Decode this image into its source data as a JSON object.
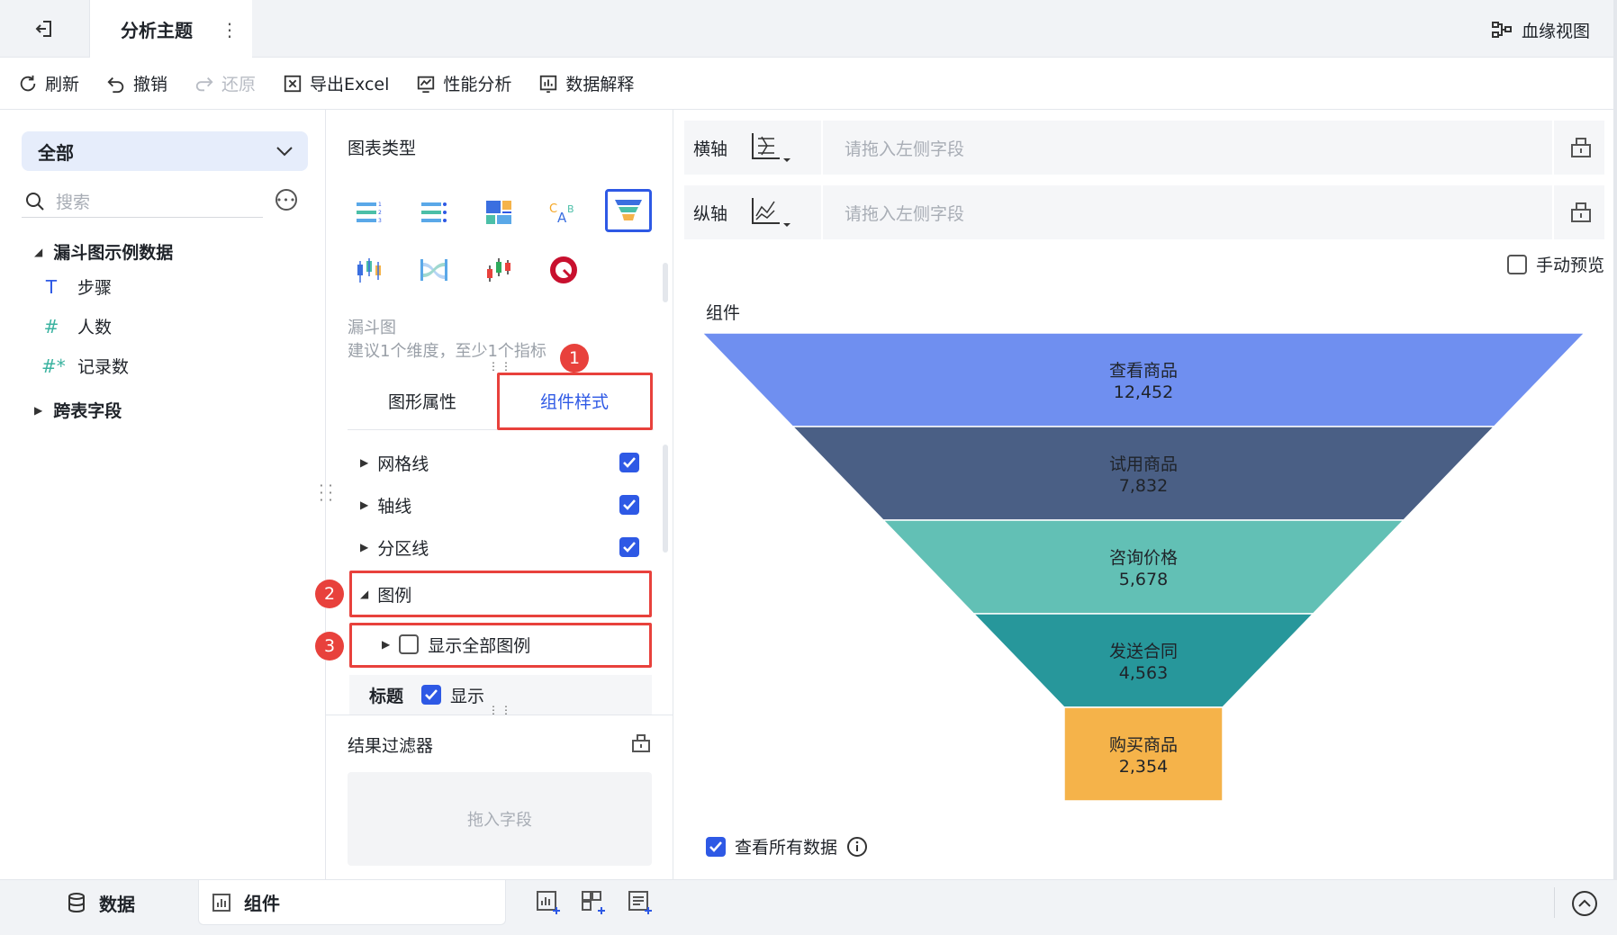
{
  "topbar": {
    "title": "分析主题",
    "more": "⋮",
    "lineage_label": "血缘视图"
  },
  "toolbar": {
    "refresh": "刷新",
    "undo": "撤销",
    "redo": "还原",
    "export_excel": "导出Excel",
    "performance": "性能分析",
    "data_explain": "数据解释"
  },
  "left": {
    "dataset_select": "全部",
    "search_placeholder": "搜索",
    "group_name": "漏斗图示例数据",
    "fields": [
      {
        "icon": "T",
        "name": "步骤"
      },
      {
        "icon": "#",
        "name": "人数"
      },
      {
        "icon": "#*",
        "name": "记录数"
      }
    ],
    "cross_table": "跨表字段"
  },
  "middle": {
    "chart_type_title": "图表类型",
    "chart_name": "漏斗图",
    "chart_hint": "建议1个维度，至少1个指标",
    "tab_shape": "图形属性",
    "tab_style": "组件样式",
    "props": {
      "grid": "网格线",
      "axis": "轴线",
      "zone": "分区线",
      "legend": "图例",
      "show_all_legend": "显示全部图例",
      "title_label": "标题",
      "title_show": "显示"
    },
    "badges": [
      "1",
      "2",
      "3"
    ],
    "filter_title": "结果过滤器",
    "filter_drop": "拖入字段"
  },
  "right": {
    "x_axis": "横轴",
    "y_axis": "纵轴",
    "drop_placeholder": "请拖入左侧字段",
    "manual_preview": "手动预览",
    "component_label": "组件",
    "see_all_data": "查看所有数据"
  },
  "chart_data": {
    "type": "funnel",
    "categories": [
      "查看商品",
      "试用商品",
      "咨询价格",
      "发送合同",
      "购买商品"
    ],
    "values": [
      12452,
      7832,
      5678,
      4563,
      2354
    ],
    "value_labels": [
      "12,452",
      "7,832",
      "5,678",
      "4,563",
      "2,354"
    ],
    "colors": [
      "#6f8ff0",
      "#4a5f85",
      "#62c0b5",
      "#27979b",
      "#f5b34a"
    ]
  },
  "bottom": {
    "data_tab": "数据",
    "component_tab": "组件"
  },
  "colors": {
    "accent": "#2e59e5",
    "highlight_red": "#e8413c"
  }
}
